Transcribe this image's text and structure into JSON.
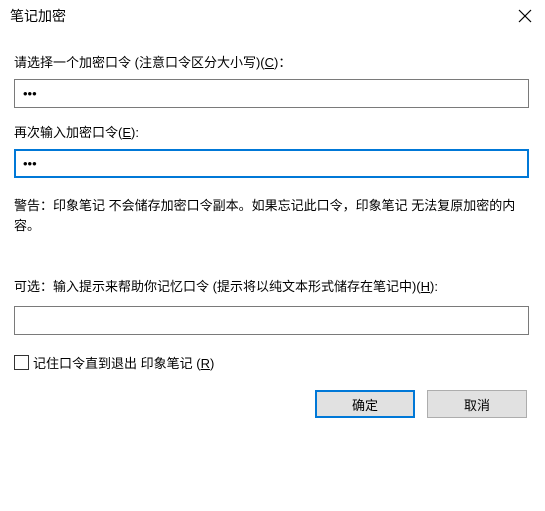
{
  "titlebar": {
    "title": "笔记加密"
  },
  "labels": {
    "password": {
      "pre": "请选择一个加密口令 (注意口令区分大小写)(",
      "u": "C",
      "post": ")："
    },
    "confirm": {
      "pre": "再次输入加密口令(",
      "u": "E",
      "post": "):"
    },
    "warning": "警告：印象笔记 不会储存加密口令副本。如果忘记此口令，印象笔记 无法复原加密的内容。",
    "hint": {
      "pre": "可选：输入提示来帮助你记忆口令 (提示将以纯文本形式储存在笔记中)(",
      "u": "H",
      "post": "):"
    },
    "remember": {
      "pre": "记住口令直到退出 印象笔记 (",
      "u": "R",
      "post": ")"
    }
  },
  "fields": {
    "password_value": "•••",
    "confirm_value": "•••",
    "hint_value": ""
  },
  "buttons": {
    "ok": "确定",
    "cancel": "取消"
  }
}
